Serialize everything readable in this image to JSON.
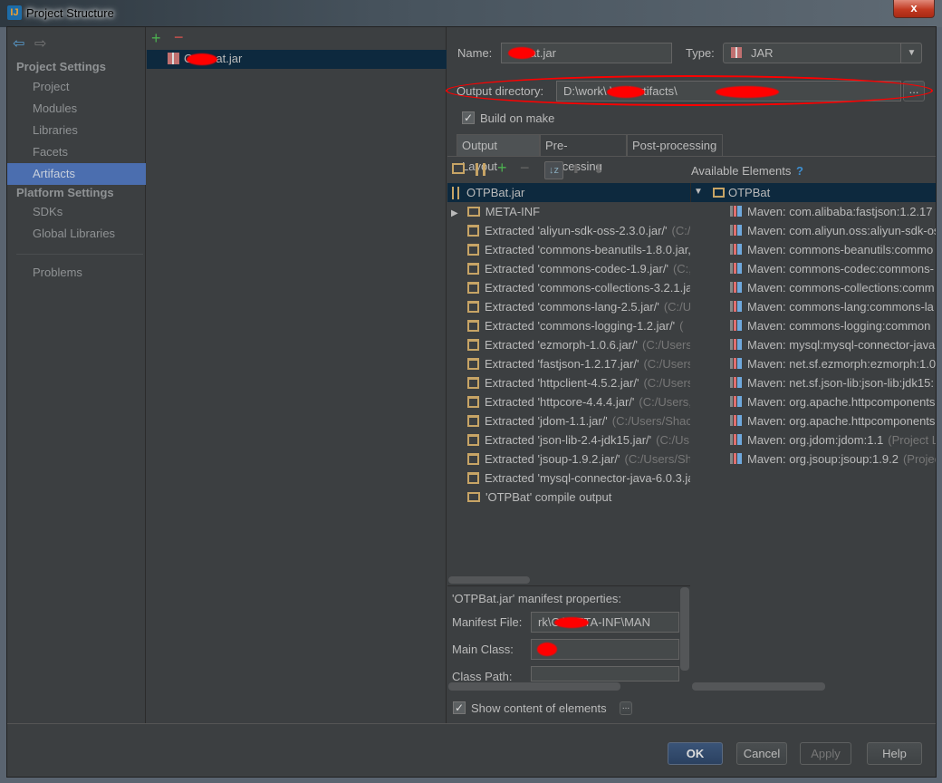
{
  "window": {
    "title": "Project Structure",
    "close_label": "x"
  },
  "sidebar": {
    "project_settings_header": "Project Settings",
    "project_items": [
      {
        "label": "Project"
      },
      {
        "label": "Modules"
      },
      {
        "label": "Libraries"
      },
      {
        "label": "Facets"
      },
      {
        "label": "Artifacts",
        "selected": true
      }
    ],
    "platform_settings_header": "Platform Settings",
    "platform_items": [
      {
        "label": "SDKs"
      },
      {
        "label": "Global Libraries"
      }
    ],
    "problems_label": "Problems"
  },
  "artifacts_list": {
    "add_label": "+",
    "remove_label": "−",
    "items": [
      {
        "label": "at.jar",
        "redacted_prefix": "C"
      }
    ]
  },
  "details": {
    "name_label": "Name:",
    "name_value": "at.jar",
    "type_label": "Type:",
    "type_value": "JAR",
    "output_dir_label": "Output directory:",
    "output_dir_value": "D:\\work\\          \\out\\artifacts\\",
    "browse_label": "...",
    "build_on_make_label": "Build on make",
    "build_on_make_checked": true,
    "tabs": [
      {
        "label": "Output Layout",
        "selected": true
      },
      {
        "label": "Pre-processing"
      },
      {
        "label": "Post-processing"
      }
    ],
    "available_elements_label": "Available Elements",
    "help_label": "?",
    "layout_root": "OTPBat.jar",
    "layout_items": [
      {
        "type": "folder",
        "text": "META-INF",
        "hint": ""
      },
      {
        "type": "extracted",
        "text": "Extracted 'aliyun-sdk-oss-2.3.0.jar/'",
        "hint": "(C:/"
      },
      {
        "type": "extracted",
        "text": "Extracted 'commons-beanutils-1.8.0.jar,",
        "hint": ""
      },
      {
        "type": "extracted",
        "text": "Extracted 'commons-codec-1.9.jar/'",
        "hint": "(C:,"
      },
      {
        "type": "extracted",
        "text": "Extracted 'commons-collections-3.2.1.ja",
        "hint": ""
      },
      {
        "type": "extracted",
        "text": "Extracted 'commons-lang-2.5.jar/'",
        "hint": "(C:/U"
      },
      {
        "type": "extracted",
        "text": "Extracted 'commons-logging-1.2.jar/'",
        "hint": "("
      },
      {
        "type": "extracted",
        "text": "Extracted 'ezmorph-1.0.6.jar/'",
        "hint": "(C:/Users"
      },
      {
        "type": "extracted",
        "text": "Extracted 'fastjson-1.2.17.jar/'",
        "hint": "(C:/Users"
      },
      {
        "type": "extracted",
        "text": "Extracted 'httpclient-4.5.2.jar/'",
        "hint": "(C:/Users"
      },
      {
        "type": "extracted",
        "text": "Extracted 'httpcore-4.4.4.jar/'",
        "hint": "(C:/Users,"
      },
      {
        "type": "extracted",
        "text": "Extracted 'jdom-1.1.jar/'",
        "hint": "(C:/Users/Shac"
      },
      {
        "type": "extracted",
        "text": "Extracted 'json-lib-2.4-jdk15.jar/'",
        "hint": "(C:/Us"
      },
      {
        "type": "extracted",
        "text": "Extracted 'jsoup-1.9.2.jar/'",
        "hint": "(C:/Users/Sh"
      },
      {
        "type": "extracted",
        "text": "Extracted 'mysql-connector-java-6.0.3.ja",
        "hint": ""
      },
      {
        "type": "output",
        "text": "'OTPBat' compile output",
        "hint": ""
      }
    ],
    "available_root": "OTPBat",
    "available_items": [
      {
        "text": "Maven: com.alibaba:fastjson:1.2.17",
        "hint": "("
      },
      {
        "text": "Maven: com.aliyun.oss:aliyun-sdk-os",
        "hint": ""
      },
      {
        "text": "Maven: commons-beanutils:commo",
        "hint": ""
      },
      {
        "text": "Maven: commons-codec:commons-",
        "hint": ""
      },
      {
        "text": "Maven: commons-collections:comm",
        "hint": ""
      },
      {
        "text": "Maven: commons-lang:commons-la",
        "hint": ""
      },
      {
        "text": "Maven: commons-logging:common",
        "hint": ""
      },
      {
        "text": "Maven: mysql:mysql-connector-java",
        "hint": ""
      },
      {
        "text": "Maven: net.sf.ezmorph:ezmorph:1.0",
        "hint": ""
      },
      {
        "text": "Maven: net.sf.json-lib:json-lib:jdk15:",
        "hint": ""
      },
      {
        "text": "Maven: org.apache.httpcomponents",
        "hint": ""
      },
      {
        "text": "Maven: org.apache.httpcomponents",
        "hint": ""
      },
      {
        "text": "Maven: org.jdom:jdom:1.1",
        "hint": "(Project L"
      },
      {
        "text": "Maven: org.jsoup:jsoup:1.9.2",
        "hint": "(Projec"
      }
    ],
    "manifest_header": "'OTPBat.jar' manifest properties:",
    "manifest_file_label": "Manifest File:",
    "manifest_file_value": "rk\\C        \\META-INF\\MAN",
    "main_class_label": "Main Class:",
    "main_class_value": "",
    "class_path_label": "Class Path:",
    "class_path_value": "",
    "show_content_label": "Show content of elements",
    "show_content_checked": true,
    "more_label": "..."
  },
  "footer": {
    "ok": "OK",
    "cancel": "Cancel",
    "apply": "Apply",
    "help": "Help"
  },
  "colors": {
    "selection": "#4b6eaf",
    "tree_selection": "#0d293e",
    "background": "#3c3f41",
    "redaction": "#ff0000"
  }
}
